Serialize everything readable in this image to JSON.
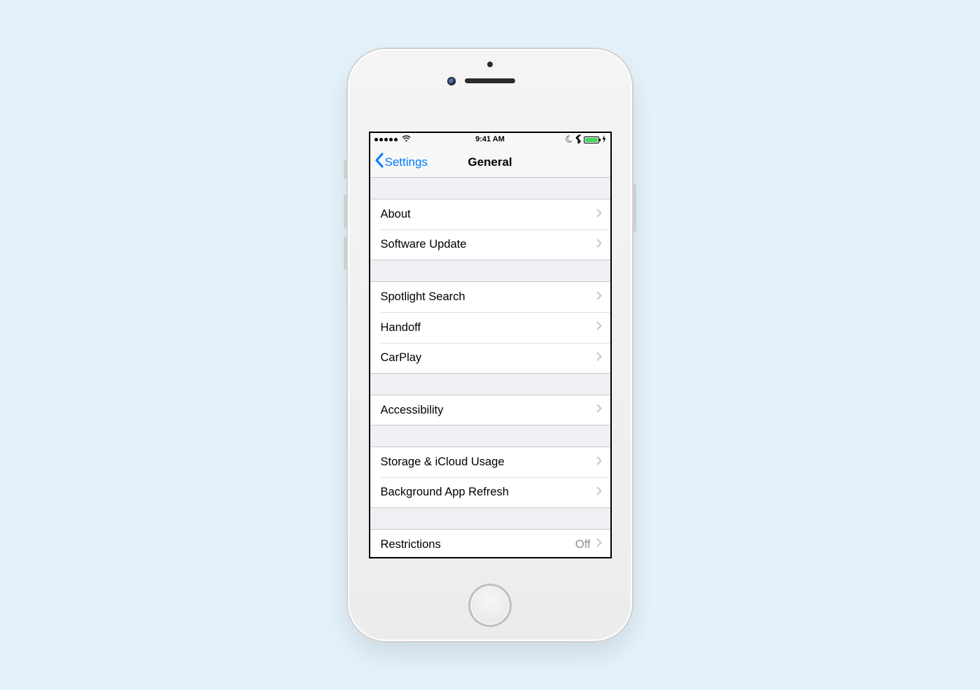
{
  "status": {
    "time": "9:41 AM"
  },
  "nav": {
    "backLabel": "Settings",
    "title": "General"
  },
  "groups": [
    {
      "rows": [
        {
          "key": "about",
          "label": "About"
        },
        {
          "key": "software-update",
          "label": "Software Update"
        }
      ]
    },
    {
      "rows": [
        {
          "key": "spotlight-search",
          "label": "Spotlight Search"
        },
        {
          "key": "handoff",
          "label": "Handoff"
        },
        {
          "key": "carplay",
          "label": "CarPlay"
        }
      ]
    },
    {
      "rows": [
        {
          "key": "accessibility",
          "label": "Accessibility"
        }
      ]
    },
    {
      "rows": [
        {
          "key": "storage-icloud",
          "label": "Storage & iCloud Usage"
        },
        {
          "key": "background-app-refresh",
          "label": "Background App Refresh"
        }
      ]
    },
    {
      "rows": [
        {
          "key": "restrictions",
          "label": "Restrictions",
          "detail": "Off"
        }
      ]
    }
  ]
}
